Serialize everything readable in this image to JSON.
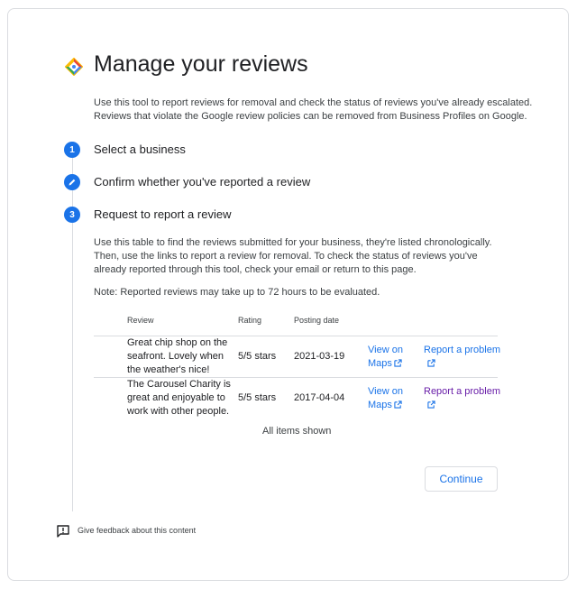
{
  "page": {
    "title": "Manage your reviews",
    "intro": "Use this tool to report reviews for removal and check the status of reviews you've already escalated. Reviews that violate the Google review policies can be removed from Business Profiles on Google."
  },
  "steps": [
    {
      "marker": "1",
      "label": "Select a business",
      "icon": "number"
    },
    {
      "marker": "",
      "label": "Confirm whether you've reported a review",
      "icon": "pencil-icon"
    },
    {
      "marker": "3",
      "label": "Request to report a review",
      "icon": "number"
    }
  ],
  "step3": {
    "description": "Use this table to find the reviews submitted for your business, they're listed chronologically. Then, use the links to report a review for removal. To check the status of reviews you've already reported through this tool, check your email or return to this page.",
    "note": "Note: Reported reviews may take up to 72 hours to be evaluated."
  },
  "table": {
    "headers": {
      "review": "Review",
      "rating": "Rating",
      "date": "Posting date"
    },
    "rows": [
      {
        "review": "Great chip shop on the seafront. Lovely when the weather's nice!",
        "rating": "5/5 stars",
        "date": "2021-03-19",
        "view_link": "View on Maps",
        "report_link": "Report a problem",
        "report_visited": false
      },
      {
        "review": "The Carousel Charity is great and enjoyable to work with other people.",
        "rating": "5/5 stars",
        "date": "2017-04-04",
        "view_link": "View on Maps",
        "report_link": "Report a problem",
        "report_visited": true
      }
    ],
    "footer": "All items shown"
  },
  "continue_button": "Continue",
  "feedback_link": "Give feedback about this content",
  "colors": {
    "accent": "#1a73e8",
    "visited": "#681da8",
    "border": "#dadce0"
  }
}
